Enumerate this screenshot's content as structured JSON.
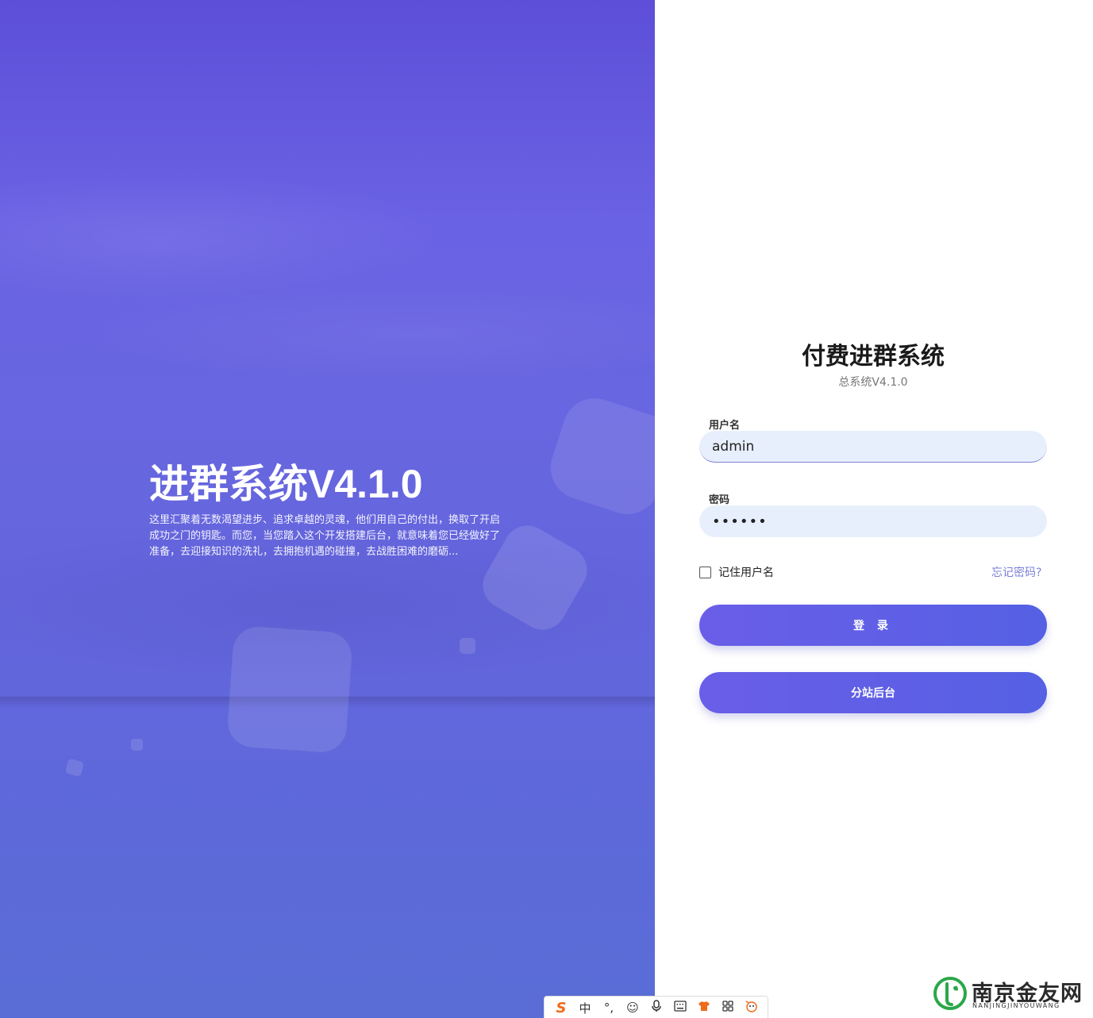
{
  "hero": {
    "title": "进群系统V4.1.0",
    "description": "这里汇聚着无数渴望进步、追求卓越的灵魂，他们用自己的付出，换取了开启成功之门的钥匙。而您，当您踏入这个开发搭建后台，就意味着您已经做好了准备，去迎接知识的洗礼，去拥抱机遇的碰撞，去战胜困难的磨砺..."
  },
  "login": {
    "title": "付费进群系统",
    "subtitle": "总系统V4.1.0",
    "username_label": "用户名",
    "username_value": "admin",
    "password_label": "密码",
    "password_value": "••••••",
    "remember_label": "记住用户名",
    "remember_checked": false,
    "forgot_label": "忘记密码?",
    "login_button": "登 录",
    "substation_button": "分站后台",
    "accent_color": "#5d5fe6"
  },
  "ime_toolbar": {
    "logo": "S",
    "mode": "中",
    "punct": "°,",
    "icons": [
      "emoji-icon",
      "microphone-icon",
      "keyboard-icon",
      "skin-icon",
      "grid-icon",
      "mascot-icon"
    ]
  },
  "watermark": {
    "name": "南京金友网",
    "pinyin": "NANJINGJINYOUWANG"
  }
}
